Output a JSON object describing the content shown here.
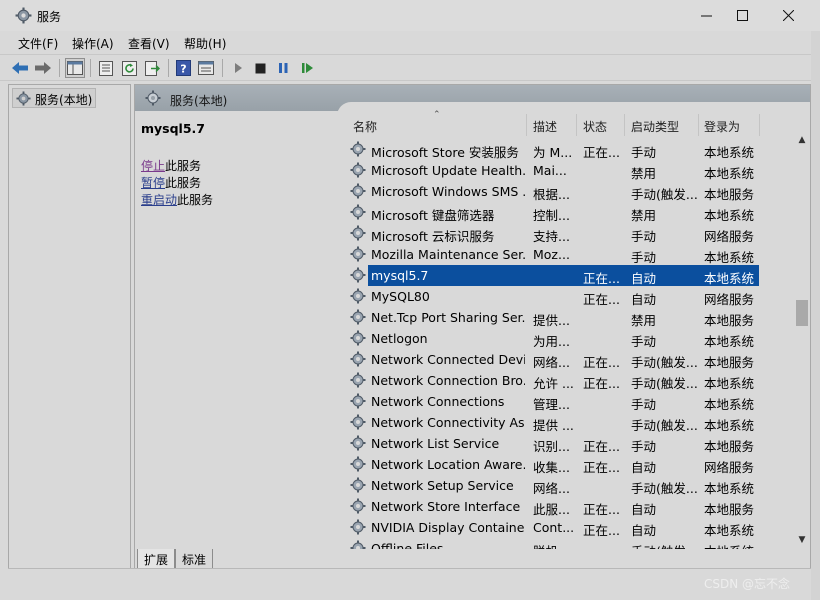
{
  "window": {
    "title": "服务",
    "controls": {
      "minimize": "minimize-icon",
      "maximize": "maximize-icon",
      "close": "close-icon"
    }
  },
  "menu": [
    "文件(F)",
    "操作(A)",
    "查看(V)",
    "帮助(H)"
  ],
  "toolbar": {
    "icons": [
      "back-icon",
      "forward-icon",
      "console-tree-icon",
      "properties-icon",
      "refresh-icon",
      "export-icon",
      "help-icon",
      "view-icon",
      "start-icon",
      "stop-icon",
      "pause-icon",
      "resume-icon"
    ]
  },
  "tree": {
    "root_label": "服务(本地)"
  },
  "pane": {
    "header_title": "服务(本地)",
    "selected_service": "mysql5.7",
    "actions": [
      {
        "link": "停止",
        "suffix": "此服务"
      },
      {
        "link": "暂停",
        "suffix": "此服务"
      },
      {
        "link": "重启动",
        "suffix": "此服务"
      }
    ]
  },
  "columns": [
    "名称",
    "描述",
    "状态",
    "启动类型",
    "登录为"
  ],
  "rows": [
    {
      "name": "Microsoft Store 安装服务",
      "desc": "为 M...",
      "status": "正在...",
      "startup": "手动",
      "logon": "本地系统"
    },
    {
      "name": "Microsoft Update Health...",
      "desc": "Mai...",
      "status": "",
      "startup": "禁用",
      "logon": "本地系统"
    },
    {
      "name": "Microsoft Windows SMS ...",
      "desc": "根据...",
      "status": "",
      "startup": "手动(触发...",
      "logon": "本地服务"
    },
    {
      "name": "Microsoft 键盘筛选器",
      "desc": "控制...",
      "status": "",
      "startup": "禁用",
      "logon": "本地系统"
    },
    {
      "name": "Microsoft 云标识服务",
      "desc": "支持...",
      "status": "",
      "startup": "手动",
      "logon": "网络服务"
    },
    {
      "name": "Mozilla Maintenance Ser...",
      "desc": "Moz...",
      "status": "",
      "startup": "手动",
      "logon": "本地系统"
    },
    {
      "name": "mysql5.7",
      "desc": "",
      "status": "正在...",
      "startup": "自动",
      "logon": "本地系统",
      "selected": true
    },
    {
      "name": "MySQL80",
      "desc": "",
      "status": "正在...",
      "startup": "自动",
      "logon": "网络服务"
    },
    {
      "name": "Net.Tcp Port Sharing Ser...",
      "desc": "提供...",
      "status": "",
      "startup": "禁用",
      "logon": "本地服务"
    },
    {
      "name": "Netlogon",
      "desc": "为用...",
      "status": "",
      "startup": "手动",
      "logon": "本地系统"
    },
    {
      "name": "Network Connected Devi...",
      "desc": "网络...",
      "status": "正在...",
      "startup": "手动(触发...",
      "logon": "本地服务"
    },
    {
      "name": "Network Connection Bro...",
      "desc": "允许 ...",
      "status": "正在...",
      "startup": "手动(触发...",
      "logon": "本地系统"
    },
    {
      "name": "Network Connections",
      "desc": "管理...",
      "status": "",
      "startup": "手动",
      "logon": "本地系统"
    },
    {
      "name": "Network Connectivity Ass...",
      "desc": "提供 ...",
      "status": "",
      "startup": "手动(触发...",
      "logon": "本地系统"
    },
    {
      "name": "Network List Service",
      "desc": "识别...",
      "status": "正在...",
      "startup": "手动",
      "logon": "本地服务"
    },
    {
      "name": "Network Location Aware...",
      "desc": "收集...",
      "status": "正在...",
      "startup": "自动",
      "logon": "网络服务"
    },
    {
      "name": "Network Setup Service",
      "desc": "网络...",
      "status": "",
      "startup": "手动(触发...",
      "logon": "本地系统"
    },
    {
      "name": "Network Store Interface ...",
      "desc": "此服...",
      "status": "正在...",
      "startup": "自动",
      "logon": "本地服务"
    },
    {
      "name": "NVIDIA Display Containe...",
      "desc": "Cont...",
      "status": "正在...",
      "startup": "自动",
      "logon": "本地系统"
    },
    {
      "name": "Offline Files",
      "desc": "脱机...",
      "status": "",
      "startup": "手动(触发...",
      "logon": "本地系统"
    }
  ],
  "tabs": [
    "扩展",
    "标准"
  ],
  "watermark": "CSDN @忘不念",
  "colors": {
    "selection": "#0b4f9e",
    "header": "#9ea7ae",
    "link": "#2a3e8c",
    "visited_link": "#7a3a8c"
  }
}
